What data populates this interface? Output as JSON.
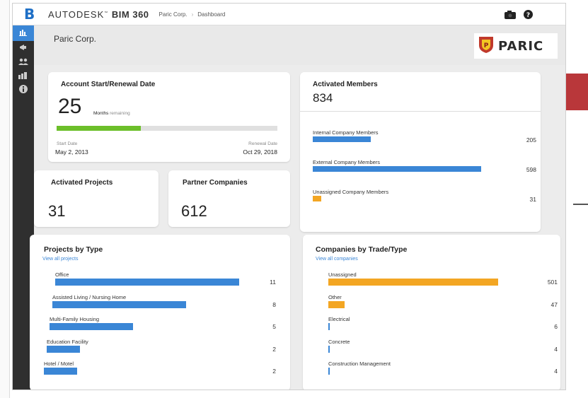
{
  "header": {
    "brand_light": "AUTODESK",
    "brand_bold": "BIM 360",
    "crumb_company": "Paric Corp.",
    "crumb_page": "Dashboard"
  },
  "company": {
    "name": "Paric Corp.",
    "logo_text": "PARIC"
  },
  "account": {
    "title": "Account Start/Renewal Date",
    "months": "25",
    "months_label": "Months",
    "remaining_label": "remaining",
    "progress_fraction": 0.38,
    "start_label": "Start Date",
    "start_date": "May 2, 2013",
    "renewal_label": "Renewal Date",
    "renewal_date": "Oct 29, 2018"
  },
  "members": {
    "title": "Activated Members",
    "total": "834",
    "rows": [
      {
        "label": "Internal Company Members",
        "value": "205",
        "fraction": 0.33,
        "color": "#3a86d6"
      },
      {
        "label": "External Company Members",
        "value": "598",
        "fraction": 0.96,
        "color": "#3a86d6"
      },
      {
        "label": "Unassigned Company Members",
        "value": "31",
        "fraction": 0.05,
        "color": "#f3a623"
      }
    ]
  },
  "projects": {
    "title": "Activated Projects",
    "value": "31"
  },
  "partners": {
    "title": "Partner Companies",
    "value": "612"
  },
  "projects_by_type": {
    "title": "Projects by Type",
    "link": "View all projects",
    "rows": [
      {
        "label": "Office",
        "value": "11",
        "fraction": 0.88,
        "color": "#3a86d6"
      },
      {
        "label": "Assisted Living / Nursing Home",
        "value": "8",
        "fraction": 0.64,
        "color": "#3a86d6"
      },
      {
        "label": "Multi-Family Housing",
        "value": "5",
        "fraction": 0.4,
        "color": "#3a86d6"
      },
      {
        "label": "Education Facility",
        "value": "2",
        "fraction": 0.16,
        "color": "#3a86d6"
      },
      {
        "label": "Hotel / Motel",
        "value": "2",
        "fraction": 0.16,
        "color": "#3a86d6"
      }
    ]
  },
  "companies_by_trade": {
    "title": "Companies by Trade/Type",
    "link": "View all companies",
    "rows": [
      {
        "label": "Unassigned",
        "value": "501",
        "fraction": 0.8,
        "color": "#f3a623"
      },
      {
        "label": "Other",
        "value": "47",
        "fraction": 0.075,
        "color": "#f3a623"
      },
      {
        "label": "Electrical",
        "value": "6",
        "fraction": 0.006,
        "color": "#3a86d6"
      },
      {
        "label": "Concrete",
        "value": "4",
        "fraction": 0.004,
        "color": "#3a86d6"
      },
      {
        "label": "Construction Management",
        "value": "4",
        "fraction": 0.004,
        "color": "#3a86d6"
      }
    ]
  },
  "colors": {
    "accent": "#3a86d6",
    "progress": "#6cbf2a",
    "warning": "#f3a623"
  },
  "icons": [
    "home-icon",
    "megaphone-icon",
    "users-icon",
    "buildings-icon",
    "info-icon",
    "camera-icon",
    "help-icon"
  ]
}
